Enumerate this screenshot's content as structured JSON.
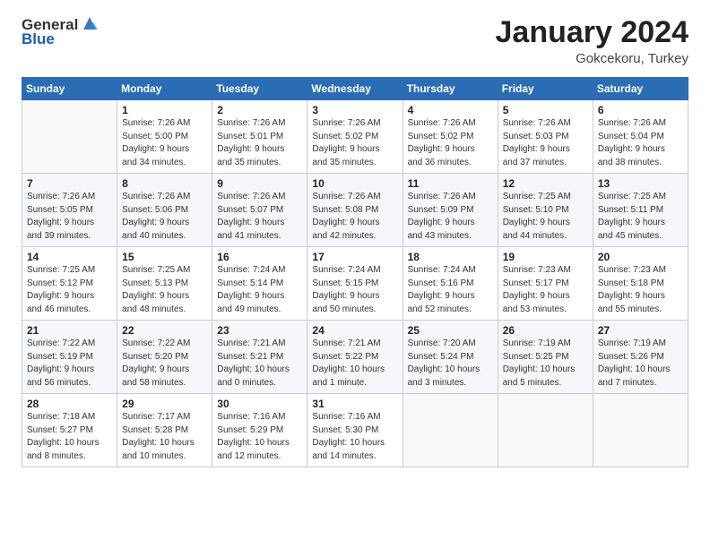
{
  "header": {
    "logo_general": "General",
    "logo_blue": "Blue",
    "title": "January 2024",
    "subtitle": "Gokcekoru, Turkey"
  },
  "weekdays": [
    "Sunday",
    "Monday",
    "Tuesday",
    "Wednesday",
    "Thursday",
    "Friday",
    "Saturday"
  ],
  "weeks": [
    [
      {
        "day": "",
        "info": ""
      },
      {
        "day": "1",
        "info": "Sunrise: 7:26 AM\nSunset: 5:00 PM\nDaylight: 9 hours\nand 34 minutes."
      },
      {
        "day": "2",
        "info": "Sunrise: 7:26 AM\nSunset: 5:01 PM\nDaylight: 9 hours\nand 35 minutes."
      },
      {
        "day": "3",
        "info": "Sunrise: 7:26 AM\nSunset: 5:02 PM\nDaylight: 9 hours\nand 35 minutes."
      },
      {
        "day": "4",
        "info": "Sunrise: 7:26 AM\nSunset: 5:02 PM\nDaylight: 9 hours\nand 36 minutes."
      },
      {
        "day": "5",
        "info": "Sunrise: 7:26 AM\nSunset: 5:03 PM\nDaylight: 9 hours\nand 37 minutes."
      },
      {
        "day": "6",
        "info": "Sunrise: 7:26 AM\nSunset: 5:04 PM\nDaylight: 9 hours\nand 38 minutes."
      }
    ],
    [
      {
        "day": "7",
        "info": "Sunrise: 7:26 AM\nSunset: 5:05 PM\nDaylight: 9 hours\nand 39 minutes."
      },
      {
        "day": "8",
        "info": "Sunrise: 7:26 AM\nSunset: 5:06 PM\nDaylight: 9 hours\nand 40 minutes."
      },
      {
        "day": "9",
        "info": "Sunrise: 7:26 AM\nSunset: 5:07 PM\nDaylight: 9 hours\nand 41 minutes."
      },
      {
        "day": "10",
        "info": "Sunrise: 7:26 AM\nSunset: 5:08 PM\nDaylight: 9 hours\nand 42 minutes."
      },
      {
        "day": "11",
        "info": "Sunrise: 7:26 AM\nSunset: 5:09 PM\nDaylight: 9 hours\nand 43 minutes."
      },
      {
        "day": "12",
        "info": "Sunrise: 7:25 AM\nSunset: 5:10 PM\nDaylight: 9 hours\nand 44 minutes."
      },
      {
        "day": "13",
        "info": "Sunrise: 7:25 AM\nSunset: 5:11 PM\nDaylight: 9 hours\nand 45 minutes."
      }
    ],
    [
      {
        "day": "14",
        "info": "Sunrise: 7:25 AM\nSunset: 5:12 PM\nDaylight: 9 hours\nand 46 minutes."
      },
      {
        "day": "15",
        "info": "Sunrise: 7:25 AM\nSunset: 5:13 PM\nDaylight: 9 hours\nand 48 minutes."
      },
      {
        "day": "16",
        "info": "Sunrise: 7:24 AM\nSunset: 5:14 PM\nDaylight: 9 hours\nand 49 minutes."
      },
      {
        "day": "17",
        "info": "Sunrise: 7:24 AM\nSunset: 5:15 PM\nDaylight: 9 hours\nand 50 minutes."
      },
      {
        "day": "18",
        "info": "Sunrise: 7:24 AM\nSunset: 5:16 PM\nDaylight: 9 hours\nand 52 minutes."
      },
      {
        "day": "19",
        "info": "Sunrise: 7:23 AM\nSunset: 5:17 PM\nDaylight: 9 hours\nand 53 minutes."
      },
      {
        "day": "20",
        "info": "Sunrise: 7:23 AM\nSunset: 5:18 PM\nDaylight: 9 hours\nand 55 minutes."
      }
    ],
    [
      {
        "day": "21",
        "info": "Sunrise: 7:22 AM\nSunset: 5:19 PM\nDaylight: 9 hours\nand 56 minutes."
      },
      {
        "day": "22",
        "info": "Sunrise: 7:22 AM\nSunset: 5:20 PM\nDaylight: 9 hours\nand 58 minutes."
      },
      {
        "day": "23",
        "info": "Sunrise: 7:21 AM\nSunset: 5:21 PM\nDaylight: 10 hours\nand 0 minutes."
      },
      {
        "day": "24",
        "info": "Sunrise: 7:21 AM\nSunset: 5:22 PM\nDaylight: 10 hours\nand 1 minute."
      },
      {
        "day": "25",
        "info": "Sunrise: 7:20 AM\nSunset: 5:24 PM\nDaylight: 10 hours\nand 3 minutes."
      },
      {
        "day": "26",
        "info": "Sunrise: 7:19 AM\nSunset: 5:25 PM\nDaylight: 10 hours\nand 5 minutes."
      },
      {
        "day": "27",
        "info": "Sunrise: 7:19 AM\nSunset: 5:26 PM\nDaylight: 10 hours\nand 7 minutes."
      }
    ],
    [
      {
        "day": "28",
        "info": "Sunrise: 7:18 AM\nSunset: 5:27 PM\nDaylight: 10 hours\nand 8 minutes."
      },
      {
        "day": "29",
        "info": "Sunrise: 7:17 AM\nSunset: 5:28 PM\nDaylight: 10 hours\nand 10 minutes."
      },
      {
        "day": "30",
        "info": "Sunrise: 7:16 AM\nSunset: 5:29 PM\nDaylight: 10 hours\nand 12 minutes."
      },
      {
        "day": "31",
        "info": "Sunrise: 7:16 AM\nSunset: 5:30 PM\nDaylight: 10 hours\nand 14 minutes."
      },
      {
        "day": "",
        "info": ""
      },
      {
        "day": "",
        "info": ""
      },
      {
        "day": "",
        "info": ""
      }
    ]
  ]
}
